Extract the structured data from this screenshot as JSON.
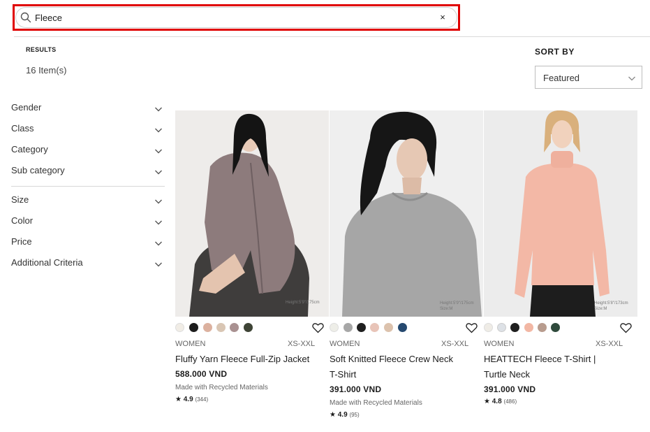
{
  "search": {
    "value": "Fleece",
    "clear_label": "×"
  },
  "results": {
    "label": "RESULTS",
    "count": "16 Item(s)"
  },
  "sort": {
    "label": "SORT BY",
    "selected": "Featured"
  },
  "filters": {
    "group1": [
      "Gender",
      "Class",
      "Category",
      "Sub category"
    ],
    "group2": [
      "Size",
      "Color",
      "Price",
      "Additional Criteria"
    ]
  },
  "products": [
    {
      "gender": "WOMEN",
      "sizes": "XS-XXL",
      "name": "Fluffy Yarn Fleece Full-Zip Jacket",
      "price": "588.000 VND",
      "note": "Made with Recycled Materials",
      "rating": "4.9",
      "reviews": "(344)",
      "model_caption": "Height:5'9\"/175cm",
      "swatches": [
        "#f1ede6",
        "#1c1c1c",
        "#dcb19f",
        "#d9c6b4",
        "#a99191",
        "#3e4436"
      ]
    },
    {
      "gender": "WOMEN",
      "sizes": "XS-XXL",
      "name": "Soft Knitted Fleece Crew Neck T-Shirt",
      "price": "391.000 VND",
      "note": "Made with Recycled Materials",
      "rating": "4.9",
      "reviews": "(95)",
      "model_caption": "Height:5'9\"/175cm Size:M",
      "swatches": [
        "#eeeee8",
        "#a7a7a7",
        "#1f1f1f",
        "#e8c4b8",
        "#dcc2ad",
        "#25496f"
      ]
    },
    {
      "gender": "WOMEN",
      "sizes": "XS-XXL",
      "name": "HEATTECH Fleece T-Shirt | Turtle Neck",
      "price": "391.000 VND",
      "note": "",
      "rating": "4.8",
      "reviews": "(486)",
      "model_caption": "Height:5'8\"/173cm Size:M",
      "swatches": [
        "#efece6",
        "#dde1e6",
        "#1f1f1f",
        "#f2b7a4",
        "#b89c8e",
        "#2f4a3c"
      ]
    }
  ],
  "colors": {
    "highlight": "#e00000",
    "text": "#1b1b1b"
  }
}
